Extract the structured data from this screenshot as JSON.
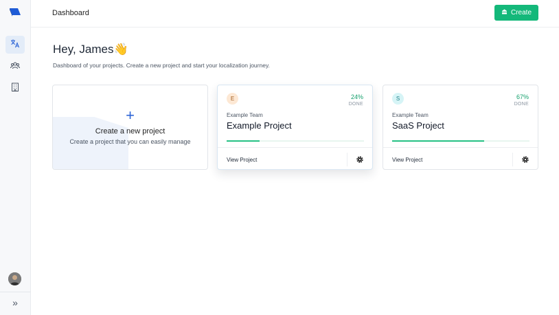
{
  "topbar": {
    "title": "Dashboard",
    "create_label": "Create"
  },
  "header": {
    "greeting": "Hey, James👋",
    "subtitle": "Dashboard of your projects. Create a new project and start your localization journey."
  },
  "new_project": {
    "plus": "+",
    "title": "Create a new project",
    "subtitle": "Create a project that you can easily manage"
  },
  "projects": [
    {
      "initial": "E",
      "progress_pct": "24%",
      "progress": 0.24,
      "done_label": "DONE",
      "team": "Example Team",
      "name": "Example Project",
      "view_label": "View Project",
      "badge_bg": "#fde8d4",
      "badge_fg": "#a15a1b"
    },
    {
      "initial": "S",
      "progress_pct": "67%",
      "progress": 0.67,
      "done_label": "DONE",
      "team": "Example Team",
      "name": "SaaS Project",
      "view_label": "View Project",
      "badge_bg": "#d6f4f6",
      "badge_fg": "#1c7d86"
    }
  ],
  "sidebar": {
    "icons": [
      "logo-icon",
      "translate-icon",
      "team-icon",
      "organization-icon"
    ],
    "expand_glyph": "»"
  },
  "colors": {
    "accent": "#14b87a",
    "brand_blue": "#2b63d6",
    "progress": "#25c184"
  }
}
